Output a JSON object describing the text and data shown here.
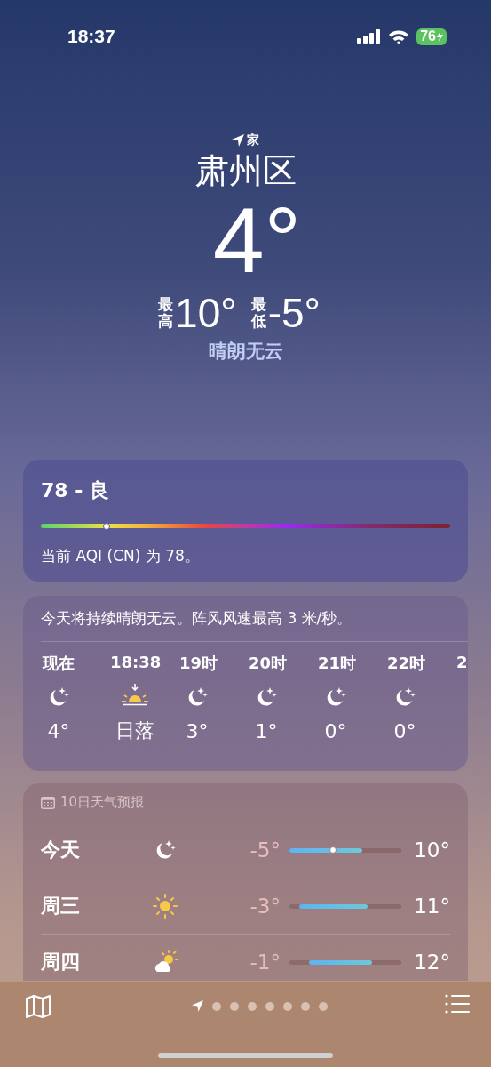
{
  "status_bar": {
    "time": "18:37",
    "battery": "76"
  },
  "header": {
    "label": "家",
    "city": "肃州区",
    "temperature": "4°",
    "high_label": "最高",
    "high": "10°",
    "low_label": "最低",
    "low": "-5°",
    "condition": "晴朗无云"
  },
  "aqi": {
    "title": "78 - 良",
    "level": 0.16,
    "description": "当前 AQI (CN) 为 78。"
  },
  "hourly": {
    "summary": "今天将持续晴朗无云。阵风风速最高 3 米/秒。",
    "items": [
      {
        "time": "现在",
        "kind": "moon",
        "temp": "4°"
      },
      {
        "time": "18:38",
        "kind": "sunset",
        "temp": "日落"
      },
      {
        "time": "19时",
        "kind": "moon",
        "temp": "3°"
      },
      {
        "time": "20时",
        "kind": "moon",
        "temp": "1°"
      },
      {
        "time": "21时",
        "kind": "moon",
        "temp": "0°"
      },
      {
        "time": "22时",
        "kind": "moon",
        "temp": "0°"
      },
      {
        "time": "2"
      }
    ]
  },
  "daily": {
    "title": "10日天气预报",
    "days": [
      {
        "day": "今天",
        "kind": "moon",
        "low": "-5°",
        "high": "10°",
        "level": 0.39
      },
      {
        "day": "周三",
        "kind": "sun",
        "low": "-3°",
        "high": "11°"
      },
      {
        "day": "周四",
        "kind": "partly",
        "low": "-1°",
        "high": "12°"
      }
    ]
  },
  "pages": [
    {
      "kind": "location",
      "selected": true
    },
    {
      "kind": "dot",
      "selected": false
    },
    {
      "kind": "dot",
      "selected": false
    },
    {
      "kind": "dot",
      "selected": false
    },
    {
      "kind": "dot",
      "selected": false
    },
    {
      "kind": "dot",
      "selected": false
    },
    {
      "kind": "dot",
      "selected": false
    },
    {
      "kind": "dot",
      "selected": false
    }
  ]
}
